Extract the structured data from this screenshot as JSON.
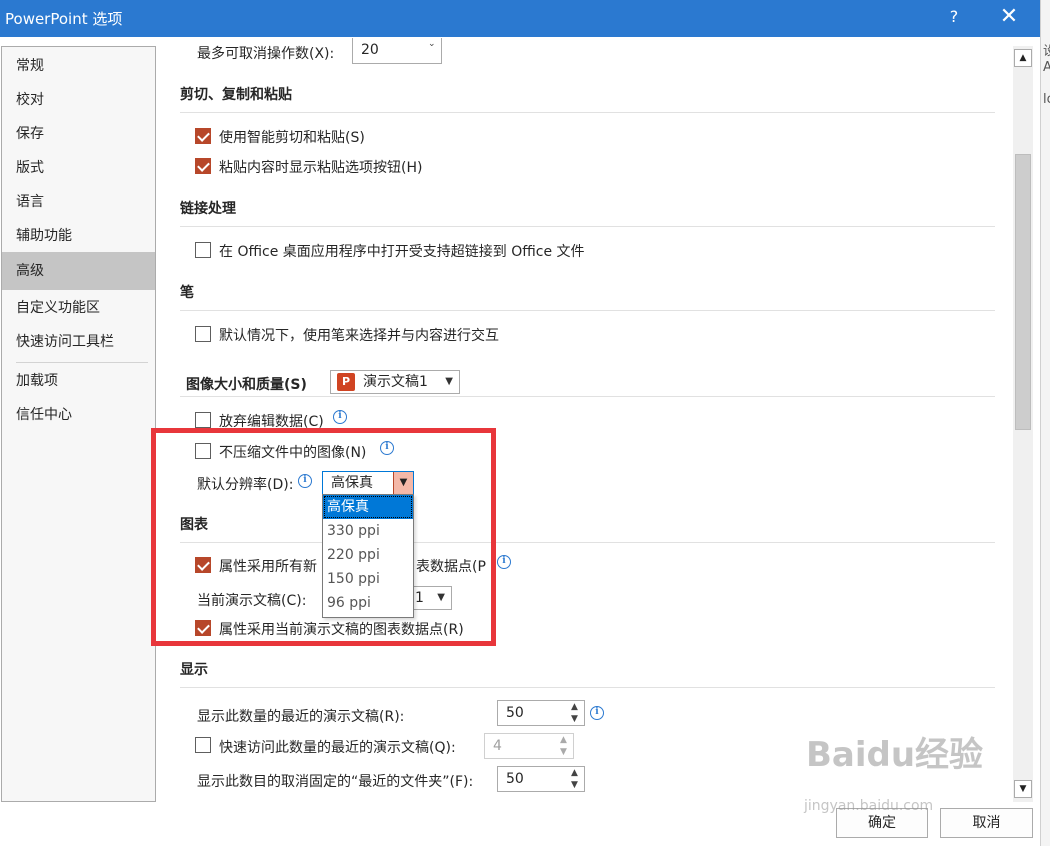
{
  "window": {
    "title": "PowerPoint 选项",
    "help": "?",
    "close": "✕"
  },
  "bg_strip": [
    "设",
    "A",
    "lo"
  ],
  "sidebar": {
    "items": [
      {
        "label": "常规"
      },
      {
        "label": "校对"
      },
      {
        "label": "保存"
      },
      {
        "label": "版式"
      },
      {
        "label": "语言"
      },
      {
        "label": "辅助功能"
      },
      {
        "label": "高级",
        "active": true
      },
      {
        "label": "自定义功能区"
      },
      {
        "label": "快速访问工具栏"
      },
      {
        "label": "加载项"
      },
      {
        "label": "信任中心"
      }
    ]
  },
  "undo": {
    "label": "最多可取消操作数(X):",
    "value": "20"
  },
  "cut_copy_paste": {
    "title": "剪切、复制和粘贴",
    "smart_cut": {
      "label": "使用智能剪切和粘贴(S)",
      "checked": true
    },
    "show_paste_options": {
      "label": "粘贴内容时显示粘贴选项按钮(H)",
      "checked": true
    }
  },
  "link_handling": {
    "title": "链接处理",
    "open_links": {
      "label": "在 Office 桌面应用程序中打开受支持超链接到 Office 文件",
      "checked": false
    }
  },
  "pen": {
    "title": "笔",
    "use_pen": {
      "label": "默认情况下，使用笔来选择并与内容进行交互",
      "checked": false
    }
  },
  "image_size_quality": {
    "title": "图像大小和质量(S)",
    "document": "演示文稿1",
    "discard_edit_data": {
      "label": "放弃编辑数据(C)",
      "checked": false
    },
    "no_compress": {
      "label": "不压缩文件中的图像(N)",
      "checked": false
    },
    "default_resolution": {
      "label": "默认分辨率(D):",
      "value": "高保真"
    },
    "resolution_options": [
      "高保真",
      "330 ppi",
      "220 ppi",
      "150 ppi",
      "96 ppi"
    ]
  },
  "chart": {
    "title": "图表",
    "all_new": {
      "label_start": "属性采用所有新",
      "label_end": "表数据点(P",
      "checked": true
    },
    "current_doc": {
      "label": "当前演示文稿(C):",
      "value_tail": "1"
    },
    "current_props": {
      "label": "属性采用当前演示文稿的图表数据点(R)",
      "checked": true
    }
  },
  "display": {
    "title": "显示",
    "recent_count": {
      "label": "显示此数量的最近的演示文稿(R):",
      "value": "50"
    },
    "quick_access_recent": {
      "label": "快速访问此数量的最近的演示文稿(Q):",
      "value": "4",
      "checked": false
    },
    "unpinned_folders": {
      "label": "显示此数目的取消固定的“最近的文件夹”(F):",
      "value": "50"
    }
  },
  "footer": {
    "ok": "确定",
    "cancel": "取消"
  },
  "watermark": {
    "logo": "Baidu经验",
    "url": "jingyan.baidu.com"
  },
  "colors": {
    "accent": "#2b79d0",
    "checkbox_checked": "#b7472a",
    "annotation": "#e8363b",
    "selection": "#0078d7"
  }
}
